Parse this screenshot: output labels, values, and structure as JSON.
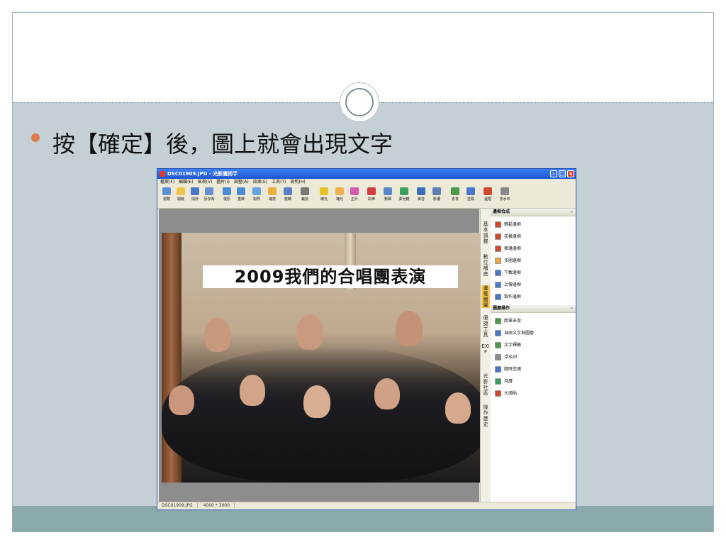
{
  "slide": {
    "bullet_text": "按【確定】後，圖上就會出現文字",
    "bullet_color": "#e07a4f"
  },
  "app": {
    "title": "DSC01909.JPG - 光影魔術手",
    "menu": [
      "檔案(F)",
      "編輯(E)",
      "檢視(V)",
      "圖片(I)",
      "調整(A)",
      "效果(E)",
      "工具(T)",
      "說明(H)"
    ],
    "toolbar": [
      {
        "label": "瀏覽",
        "icon": "browse-icon",
        "color": "#5b8fd6"
      },
      {
        "label": "開啟",
        "icon": "folder-icon",
        "color": "#f1c14a"
      },
      {
        "label": "儲存",
        "icon": "save-icon",
        "color": "#4a78c8"
      },
      {
        "label": "另存為",
        "icon": "save-as-icon",
        "color": "#6a8fd0"
      },
      {
        "label": "復原",
        "icon": "undo-icon",
        "color": "#4a8bd8"
      },
      {
        "label": "重做",
        "icon": "redo-icon",
        "color": "#4a8bd8"
      },
      {
        "label": "對照",
        "icon": "compare-icon",
        "color": "#66a4e0"
      },
      {
        "label": "縮放",
        "icon": "zoom-icon",
        "color": "#e9b13c"
      },
      {
        "label": "旋轉",
        "icon": "rotate-icon",
        "color": "#5a7fc8"
      },
      {
        "label": "裁剪",
        "icon": "crop-icon",
        "color": "#777777"
      },
      {
        "label": "曝光",
        "icon": "exposure-icon",
        "color": "#e6c22a"
      },
      {
        "label": "補光",
        "icon": "fill-light-icon",
        "color": "#f0b04a"
      },
      {
        "label": "正片",
        "icon": "film-icon",
        "color": "#d45bb0"
      },
      {
        "label": "彩棒",
        "icon": "color-bar-icon",
        "color": "#d04040"
      },
      {
        "label": "數碼",
        "icon": "digital-icon",
        "color": "#5588cc"
      },
      {
        "label": "柔光鏡",
        "icon": "soft-light-icon",
        "color": "#3aa060"
      },
      {
        "label": "美容",
        "icon": "beauty-icon",
        "color": "#3a6fb8"
      },
      {
        "label": "影樓",
        "icon": "studio-icon",
        "color": "#5c7fb0"
      },
      {
        "label": "去背",
        "icon": "remove-bg-icon",
        "color": "#4a9a4a"
      },
      {
        "label": "塗鴉",
        "icon": "doodle-icon",
        "color": "#4a76c8"
      },
      {
        "label": "邊框",
        "icon": "frame-icon",
        "color": "#d04a2a"
      },
      {
        "label": "浮水印",
        "icon": "watermark-icon",
        "color": "#888888"
      }
    ],
    "photo_caption": "2009我們的合唱團表演",
    "vtabs": [
      {
        "label": "基本調整",
        "active": false
      },
      {
        "label": "數位補底",
        "active": false
      },
      {
        "label": "邊框圖層",
        "active": true
      },
      {
        "label": "便捷工具",
        "active": false
      },
      {
        "label": "EXIF",
        "active": false
      },
      {
        "label": "光影社區",
        "active": false
      },
      {
        "label": "操作歷史",
        "active": false
      }
    ],
    "panel1": {
      "title": "邊框合成",
      "items": [
        {
          "label": "輕鬆邊框",
          "color": "#d04a2a"
        },
        {
          "label": "花樣邊框",
          "color": "#d04a2a"
        },
        {
          "label": "撕邊邊框",
          "color": "#d04a2a"
        },
        {
          "label": "多圖邊框",
          "color": "#e9a63c"
        },
        {
          "label": "下載邊框",
          "color": "#4a78c8"
        },
        {
          "label": "上傳邊框",
          "color": "#4a78c8"
        },
        {
          "label": "製作邊框",
          "color": "#4a78c8"
        }
      ]
    },
    "panel2": {
      "title": "圖層操作",
      "items": [
        {
          "label": "簡單去背",
          "color": "#4a9a4a"
        },
        {
          "label": "自由文字與圖層",
          "color": "#4a78c8"
        },
        {
          "label": "文字標籤",
          "color": "#4a9a4a"
        },
        {
          "label": "浮水印",
          "color": "#888888"
        },
        {
          "label": "隨時塗鴉",
          "color": "#4a76c8"
        },
        {
          "label": "月曆",
          "color": "#3aa060"
        },
        {
          "label": "大頭貼",
          "color": "#d04a2a"
        }
      ]
    },
    "status": {
      "filename": "DSC01909.JPG",
      "dimensions": "4000 * 3000"
    }
  }
}
